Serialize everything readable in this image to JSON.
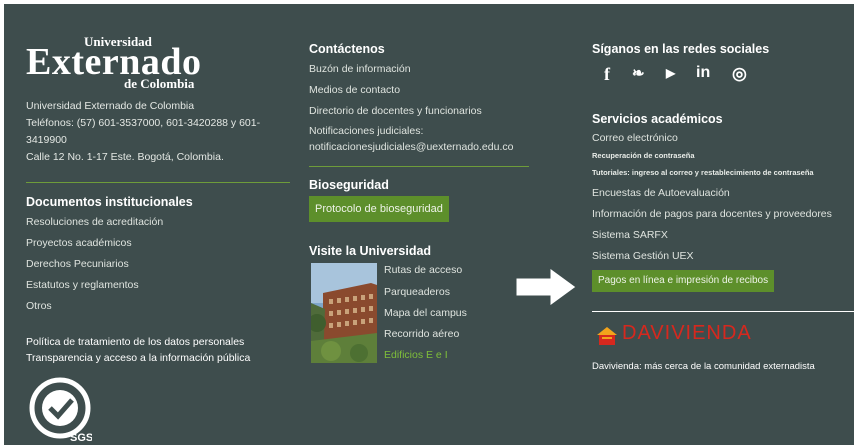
{
  "logo": {
    "line1": "Universidad",
    "line2": "Externado",
    "line3": "de Colombia"
  },
  "address": {
    "line1": "Universidad Externado de Colombia",
    "line2": "Teléfonos: (57) 601-3537000, 601-3420288 y 601-",
    "line3": "3419900",
    "line4": "Calle 12 No. 1-17 Este. Bogotá, Colombia."
  },
  "docs": {
    "title": "Documentos institucionales",
    "items": [
      "Resoluciones de acreditación",
      "Proyectos académicos",
      "Derechos Pecuniarios",
      "Estatutos y reglamentos",
      "Otros"
    ]
  },
  "policy": {
    "line1": "Política de tratamiento de los datos personales",
    "line2": "Transparencia y acceso a la información pública"
  },
  "cert": {
    "text": "SGS"
  },
  "contact": {
    "title": "Contáctenos",
    "items": [
      "Buzón de información",
      "Medios de contacto",
      "Directorio de docentes y funcionarios",
      "Notificaciones judiciales:",
      "notificacionesjudiciales@uexternado.edu.co"
    ]
  },
  "bio": {
    "title": "Bioseguridad",
    "button": "Protocolo de bioseguridad"
  },
  "visit": {
    "title": "Visite la Universidad",
    "items": [
      "Rutas de acceso",
      "Parqueaderos",
      "Mapa del campus",
      "Recorrido aéreo"
    ],
    "highlight": "Edificios E e I"
  },
  "social": {
    "title": "Síganos en las redes sociales",
    "icons": [
      {
        "name": "facebook-icon",
        "glyph": "f"
      },
      {
        "name": "twitter-icon",
        "glyph": "❧"
      },
      {
        "name": "youtube-icon",
        "glyph": "▶"
      },
      {
        "name": "linkedin-icon",
        "glyph": "in"
      },
      {
        "name": "instagram-icon",
        "glyph": "◎"
      }
    ]
  },
  "services": {
    "title": "Servicios académicos",
    "email": "Correo electrónico",
    "recovery": "Recuperación de contraseña",
    "tutorials": "Tutoriales: ingreso al correo y restablecimiento de contraseña",
    "items": [
      "Encuestas de Autoevaluación",
      "Información de pagos para docentes y proveedores",
      "Sistema SARFX",
      "Sistema Gestión UEX"
    ],
    "pay_button": "Pagos en línea e impresión de recibos"
  },
  "bank": {
    "name": "DAVIVIENDA",
    "tagline": "Davivienda: más cerca de la comunidad externadista"
  },
  "colors": {
    "bg": "#3e4d4d",
    "accent": "#5d8f2b",
    "bank_red": "#d6281e"
  }
}
